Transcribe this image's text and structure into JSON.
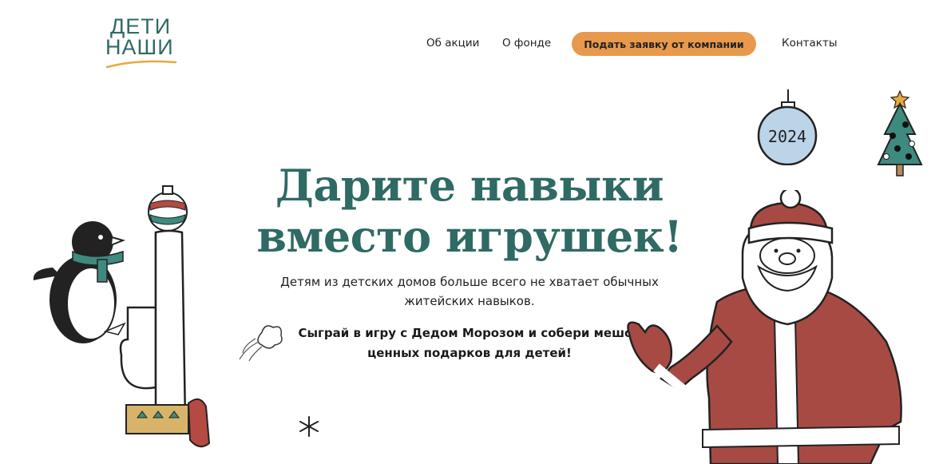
{
  "logo": {
    "line1": "ДЕТИ",
    "line2": "НАШИ"
  },
  "nav": {
    "about": "Об акции",
    "fund": "О фонде",
    "cta": "Подать заявку от компании",
    "contacts": "Контакты"
  },
  "hero": {
    "title": "Дарите навыки вместо игрушек!",
    "text1": "Детям из детских домов больше всего не хватает обычных житейских навыков.",
    "text2": "Сыграй в игру с Дедом Морозом и собери мешок ценных подарков для детей!"
  },
  "ornament": {
    "year": "2024"
  },
  "colors": {
    "brand": "#2f6a64",
    "accent": "#e8994c",
    "santa": "#a84a44"
  }
}
